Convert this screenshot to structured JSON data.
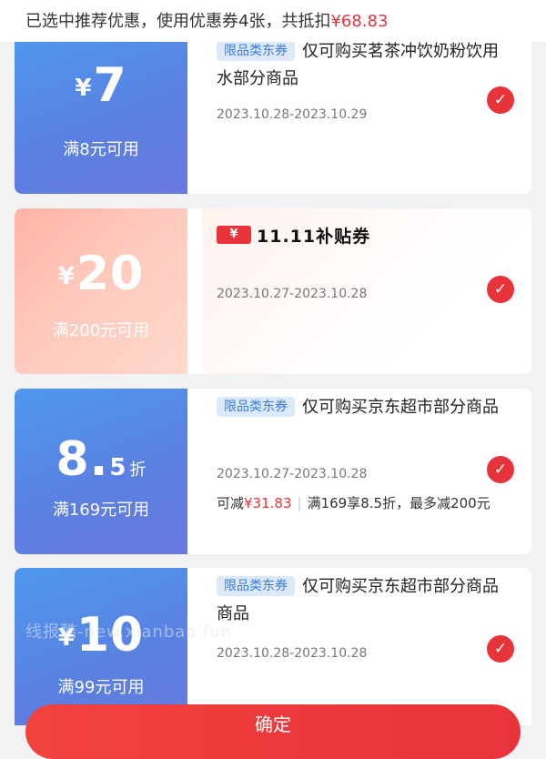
{
  "summary": {
    "text": "已选中推荐优惠，使用优惠券4张，共抵扣",
    "amount": "¥68.83"
  },
  "coupons": [
    {
      "currency": "¥",
      "value": "7",
      "condition": "满8元可用",
      "tag": "限品类东券",
      "title": "仅可购买茗茶冲饮奶粉饮用水部分商品",
      "dates": "2023.10.28-2023.10.29"
    },
    {
      "currency": "¥",
      "value": "20",
      "condition": "满200元可用",
      "badge": "¥",
      "brand": "11.11补贴券",
      "dates": "2023.10.27-2023.10.28"
    },
    {
      "value_int": "8",
      "value_dot": ".",
      "value_dec": "5",
      "unit": "折",
      "condition": "满169元可用",
      "tag": "限品类东券",
      "title": "仅可购买京东超市部分商品",
      "dates": "2023.10.27-2023.10.28",
      "desc_prefix": "可减",
      "desc_amount": "¥31.83",
      "desc_sep": "|",
      "desc_rule": "满169享8.5折，最多减200元"
    },
    {
      "currency": "¥",
      "value": "10",
      "condition": "满99元可用",
      "tag": "限品类东券",
      "title": "仅可购买京东超市部分商品商品",
      "dates": "2023.10.28-2023.10.28"
    }
  ],
  "watermark": "线报酷-new.xianbao.fun",
  "confirm_label": "确定",
  "check_icon": "check-icon",
  "colors": {
    "accent_red": "#e8333a",
    "blue_coupon": "#5b86e5",
    "pink_coupon": "#ffc2b5"
  }
}
